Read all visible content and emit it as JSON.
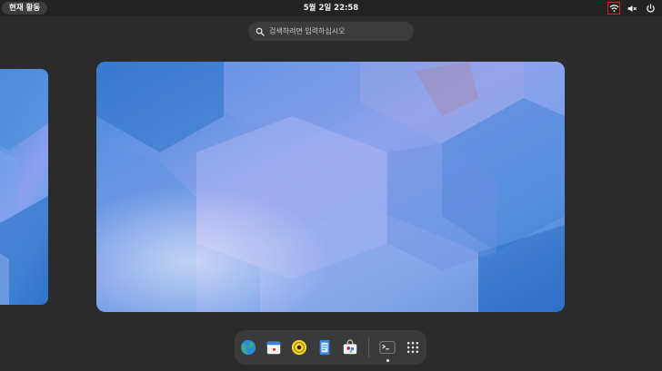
{
  "topbar": {
    "activities_label": "현재 활동",
    "clock": "5월 2일  22:58",
    "status_icons": [
      "wifi-icon",
      "speaker-muted-icon",
      "power-icon"
    ]
  },
  "search": {
    "placeholder": "검색하려면 입력하십시오"
  },
  "dock": {
    "apps": [
      {
        "name": "web-browser",
        "icon": "globe-icon"
      },
      {
        "name": "calendar",
        "icon": "calendar-icon"
      },
      {
        "name": "rhythmbox",
        "icon": "music-disc-icon"
      },
      {
        "name": "text-editor",
        "icon": "document-icon"
      },
      {
        "name": "software",
        "icon": "software-bag-icon"
      },
      {
        "name": "terminal",
        "icon": "terminal-icon",
        "running": true
      },
      {
        "name": "show-apps",
        "icon": "app-grid-icon"
      }
    ]
  },
  "colors": {
    "panel": "#232323",
    "background": "#2b2b2b",
    "accent_blue": "#3a7fd3",
    "highlight_red": "#e02020"
  }
}
